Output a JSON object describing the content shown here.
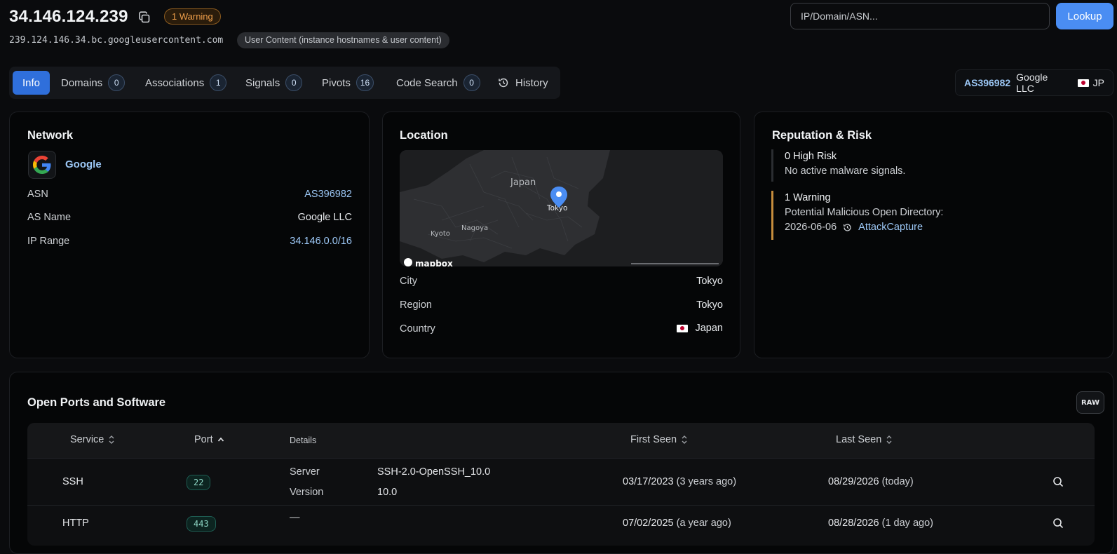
{
  "header": {
    "ip": "34.146.124.239",
    "warning_badge": "1 Warning",
    "hostname": "239.124.146.34.bc.googleusercontent.com",
    "host_badge": "User Content (instance hostnames & user content)",
    "search_placeholder": "IP/Domain/ASN...",
    "lookup_label": "Lookup"
  },
  "tabs": [
    {
      "label": "Info",
      "active": true
    },
    {
      "label": "Domains",
      "count": "0"
    },
    {
      "label": "Associations",
      "count": "1"
    },
    {
      "label": "Signals",
      "count": "0"
    },
    {
      "label": "Pivots",
      "count": "16"
    },
    {
      "label": "Code Search",
      "count": "0"
    },
    {
      "label": "History",
      "icon": "history-icon"
    }
  ],
  "asn_summary": {
    "asn": "AS396982",
    "name": "Google LLC",
    "country_code": "JP"
  },
  "network": {
    "title": "Network",
    "org": "Google",
    "rows": [
      {
        "label": "ASN",
        "value": "AS396982"
      },
      {
        "label": "AS Name",
        "value": "Google LLC"
      },
      {
        "label": "IP Range",
        "value": "34.146.0.0/16"
      }
    ]
  },
  "location": {
    "title": "Location",
    "map_labels": {
      "country": "Japan",
      "city_pin": "Tokyo",
      "city2": "Nagoya",
      "city3": "Kyoto",
      "attribution": "mapbox"
    },
    "rows": [
      {
        "label": "City",
        "value": "Tokyo"
      },
      {
        "label": "Region",
        "value": "Tokyo"
      },
      {
        "label": "Country",
        "value": "Japan"
      }
    ]
  },
  "reputation": {
    "title": "Reputation & Risk",
    "high_risk_title": "0 High Risk",
    "high_risk_desc": "No active malware signals.",
    "warning_title": "1 Warning",
    "warning_desc": "Potential Malicious Open Directory:",
    "warning_date": "2026-06-06",
    "warning_source": "AttackCapture"
  },
  "ports": {
    "title": "Open Ports and Software",
    "raw_label": "RAW",
    "columns": {
      "service": "Service",
      "port": "Port",
      "details": "Details",
      "first_seen": "First Seen",
      "last_seen": "Last Seen"
    },
    "rows": [
      {
        "service": "SSH",
        "port": "22",
        "details": [
          {
            "k": "Server",
            "v": "SSH-2.0-OpenSSH_10.0"
          },
          {
            "k": "Version",
            "v": "10.0"
          }
        ],
        "first_seen": "03/17/2023",
        "first_seen_rel": "(3 years ago)",
        "last_seen": "08/29/2026",
        "last_seen_rel": "(today)"
      },
      {
        "service": "HTTP",
        "port": "443",
        "details_empty": "—",
        "first_seen": "07/02/2025",
        "first_seen_rel": "(a year ago)",
        "last_seen": "08/28/2026",
        "last_seen_rel": "(1 day ago)"
      }
    ]
  },
  "colors": {
    "accent": "#4a8df3",
    "link": "#9cc7f5",
    "warning": "#f0a04b",
    "background": "#0a0b0d"
  }
}
